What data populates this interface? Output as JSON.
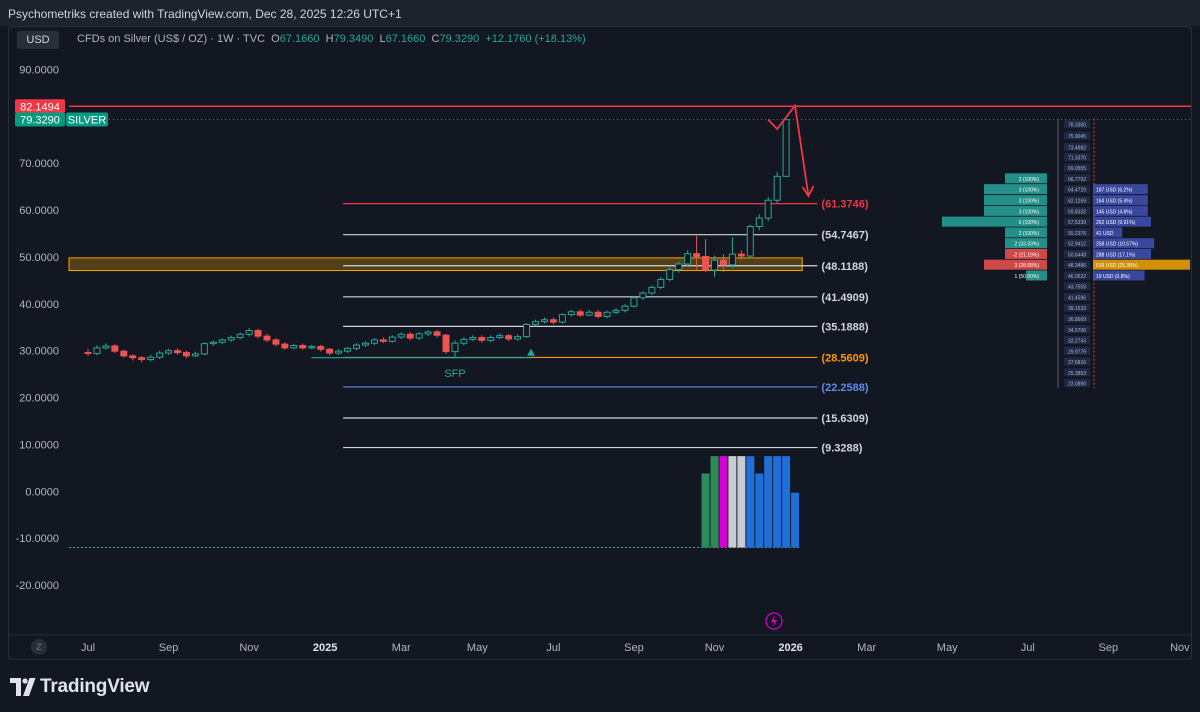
{
  "header": {
    "credit": "Psychometriks created with TradingView.com, Dec 28, 2025 12:26 UTC+1"
  },
  "toolbar": {
    "currency": "USD"
  },
  "legend": {
    "title": "CFDs on Silver (US$ / OZ) · 1W · TVC",
    "open_key": "O",
    "open": "67.1660",
    "high_key": "H",
    "high": "79.3490",
    "low_key": "L",
    "low": "67.1660",
    "close_key": "C",
    "close": "79.3290",
    "change": "+12.1760 (+18.13%)"
  },
  "footer": {
    "brand": "TradingView",
    "zoom_label": "Z"
  },
  "colors": {
    "up": "#26a69a",
    "down": "#ef5350",
    "background": "#131722",
    "resistance": "#f23645",
    "zone": "#f7a600",
    "volume_blue": "#1e6fd9",
    "volume_magenta": "#d500d5",
    "volume_gray": "#c9cbd2",
    "volume_green": "#2e8b57"
  },
  "icons": [
    "lightning-icon",
    "tradingview-logo-icon"
  ],
  "chart_data": {
    "type": "candlestick",
    "symbol": "SILVER",
    "timeframe": "1W",
    "ylim": [
      -20,
      90
    ],
    "y_ticks": [
      "90.0000",
      "80.0000",
      "70.0000",
      "60.0000",
      "50.0000",
      "40.0000",
      "30.0000",
      "20.0000",
      "10.0000",
      "0.0000",
      "-10.0000",
      "-20.0000"
    ],
    "x_ticks": [
      "Jul",
      "Sep",
      "Nov",
      "2025",
      "Mar",
      "May",
      "Jul",
      "Sep",
      "Nov",
      "2026",
      "Mar",
      "May",
      "Jul",
      "Sep",
      "Nov"
    ],
    "x_ticks_bold": [
      "2025",
      "2026"
    ],
    "x_tick_weeks": [
      0,
      9,
      18,
      26.5,
      35,
      43.5,
      52,
      61,
      70,
      78.5,
      87,
      96,
      105,
      114,
      122
    ],
    "price_labels": [
      {
        "text": "82.1494",
        "price": 82.1494,
        "color": "#f23645"
      },
      {
        "text": "79.3290",
        "price": 79.329,
        "color": "#089981",
        "tag": "SILVER"
      }
    ],
    "fib_levels": [
      {
        "label": "(61.3746)",
        "value": 61.3746,
        "color": "#f23645"
      },
      {
        "label": "(54.7467)",
        "value": 54.7467,
        "color": "#d1d4dc"
      },
      {
        "label": "(48.1188)",
        "value": 48.1188,
        "color": "#d1d4dc"
      },
      {
        "label": "(41.4909)",
        "value": 41.4909,
        "color": "#d1d4dc"
      },
      {
        "label": "(35.1888)",
        "value": 35.1888,
        "color": "#d1d4dc"
      },
      {
        "label": "(28.5609)",
        "value": 28.5609,
        "color": "#ff9800"
      },
      {
        "label": "(22.2588)",
        "value": 22.2588,
        "color": "#5b8def"
      },
      {
        "label": "(15.6309)",
        "value": 15.6309,
        "color": "#d1d4dc"
      },
      {
        "label": "(9.3288)",
        "value": 9.3288,
        "color": "#d1d4dc"
      }
    ],
    "annotations": [
      {
        "text": "SFP",
        "week": 41,
        "price": 25.2
      }
    ],
    "resistance_line": 82.1494,
    "zone": [
      47.1,
      49.8
    ],
    "projection_path": [
      [
        76,
        79.3
      ],
      [
        77,
        77.3
      ],
      [
        79,
        82.3
      ],
      [
        80.5,
        63.0
      ]
    ],
    "candles": [
      [
        29.6,
        29.4,
        30.4,
        28.9
      ],
      [
        29.4,
        30.6,
        31.2,
        29.0
      ],
      [
        30.6,
        31.0,
        31.6,
        30.2
      ],
      [
        31.0,
        29.9,
        31.4,
        29.5
      ],
      [
        29.9,
        28.9,
        30.2,
        28.5
      ],
      [
        28.9,
        28.5,
        29.2,
        27.9
      ],
      [
        28.5,
        28.1,
        28.9,
        27.5
      ],
      [
        28.1,
        28.6,
        29.1,
        27.7
      ],
      [
        28.6,
        29.5,
        30.0,
        28.2
      ],
      [
        29.5,
        30.0,
        30.4,
        29.1
      ],
      [
        30.0,
        29.6,
        30.5,
        29.1
      ],
      [
        29.6,
        28.9,
        30.0,
        28.4
      ],
      [
        28.9,
        29.3,
        29.8,
        28.6
      ],
      [
        29.3,
        31.5,
        31.8,
        29.0
      ],
      [
        31.5,
        31.8,
        32.2,
        31.0
      ],
      [
        31.8,
        32.3,
        32.6,
        31.4
      ],
      [
        32.3,
        32.8,
        33.2,
        31.9
      ],
      [
        32.8,
        33.5,
        33.9,
        32.4
      ],
      [
        33.5,
        34.3,
        34.8,
        33.0
      ],
      [
        34.3,
        33.1,
        34.7,
        32.6
      ],
      [
        33.1,
        32.3,
        33.6,
        31.8
      ],
      [
        32.3,
        31.4,
        32.7,
        30.9
      ],
      [
        31.4,
        30.6,
        31.8,
        30.2
      ],
      [
        30.6,
        31.1,
        31.5,
        30.3
      ],
      [
        31.1,
        30.6,
        31.5,
        30.2
      ],
      [
        30.6,
        30.9,
        31.3,
        30.3
      ],
      [
        30.9,
        30.3,
        31.2,
        29.8
      ],
      [
        30.3,
        29.5,
        30.6,
        29.0
      ],
      [
        29.5,
        29.9,
        30.3,
        29.1
      ],
      [
        29.9,
        30.5,
        30.8,
        29.5
      ],
      [
        30.5,
        31.2,
        31.6,
        30.1
      ],
      [
        31.2,
        31.6,
        32.0,
        30.8
      ],
      [
        31.6,
        32.3,
        32.7,
        31.2
      ],
      [
        32.3,
        32.0,
        32.8,
        31.6
      ],
      [
        32.0,
        32.9,
        33.3,
        31.7
      ],
      [
        32.9,
        33.5,
        33.9,
        32.5
      ],
      [
        33.5,
        32.7,
        34.0,
        32.2
      ],
      [
        32.7,
        33.6,
        34.0,
        32.3
      ],
      [
        33.6,
        34.0,
        34.4,
        33.1
      ],
      [
        34.0,
        33.3,
        34.4,
        32.8
      ],
      [
        33.3,
        29.8,
        33.6,
        29.3
      ],
      [
        29.8,
        31.6,
        32.2,
        28.6
      ],
      [
        31.6,
        32.4,
        32.9,
        31.1
      ],
      [
        32.4,
        32.8,
        33.3,
        32.0
      ],
      [
        32.8,
        32.2,
        33.3,
        31.7
      ],
      [
        32.2,
        32.8,
        33.3,
        31.8
      ],
      [
        32.8,
        33.2,
        33.7,
        32.4
      ],
      [
        33.2,
        32.5,
        33.6,
        32.0
      ],
      [
        32.5,
        33.0,
        33.5,
        32.1
      ],
      [
        33.0,
        35.6,
        35.9,
        32.7
      ],
      [
        35.6,
        36.2,
        36.6,
        35.2
      ],
      [
        36.2,
        36.6,
        37.1,
        35.8
      ],
      [
        36.6,
        36.1,
        37.1,
        35.6
      ],
      [
        36.1,
        37.7,
        38.0,
        35.8
      ],
      [
        37.7,
        38.3,
        38.7,
        37.3
      ],
      [
        38.3,
        37.6,
        38.8,
        37.2
      ],
      [
        37.6,
        38.2,
        38.7,
        37.3
      ],
      [
        38.2,
        37.3,
        38.7,
        36.9
      ],
      [
        37.3,
        38.2,
        38.6,
        36.9
      ],
      [
        38.2,
        38.6,
        39.1,
        37.8
      ],
      [
        38.6,
        39.5,
        39.9,
        38.2
      ],
      [
        39.5,
        41.3,
        41.7,
        39.2
      ],
      [
        41.3,
        42.3,
        42.7,
        40.8
      ],
      [
        42.3,
        43.5,
        43.9,
        41.9
      ],
      [
        43.5,
        45.2,
        45.7,
        43.1
      ],
      [
        45.2,
        47.3,
        47.8,
        44.8
      ],
      [
        47.3,
        48.5,
        49.0,
        46.6
      ],
      [
        48.5,
        50.7,
        51.4,
        47.9
      ],
      [
        50.7,
        50.1,
        54.5,
        47.3
      ],
      [
        50.1,
        47.2,
        53.8,
        46.8
      ],
      [
        47.2,
        49.3,
        50.3,
        45.7
      ],
      [
        49.3,
        48.3,
        50.6,
        46.8
      ],
      [
        48.3,
        50.6,
        54.2,
        47.6
      ],
      [
        50.6,
        50.2,
        51.4,
        49.4
      ],
      [
        50.2,
        56.5,
        56.9,
        49.8
      ],
      [
        56.5,
        58.3,
        59.1,
        55.7
      ],
      [
        58.3,
        62.1,
        62.8,
        57.6
      ],
      [
        62.1,
        67.2,
        68.1,
        61.5
      ],
      [
        67.2,
        79.3,
        79.4,
        67.2
      ]
    ],
    "volume_bars": [
      {
        "week": 69,
        "value": 3.8,
        "color": "#2e8b57"
      },
      {
        "week": 70,
        "value": 7.5,
        "color": "#2e8b57"
      },
      {
        "week": 71,
        "value": 7.5,
        "color": "#d500d5"
      },
      {
        "week": 72,
        "value": 7.5,
        "color": "#c9cbd2"
      },
      {
        "week": 73,
        "value": 7.5,
        "color": "#c9cbd2"
      },
      {
        "week": 74,
        "value": 7.5,
        "color": "#1e6fd9"
      },
      {
        "week": 75,
        "value": 3.8,
        "color": "#1e6fd9"
      },
      {
        "week": 76,
        "value": 7.5,
        "color": "#1e6fd9"
      },
      {
        "week": 77,
        "value": 7.5,
        "color": "#1e6fd9"
      },
      {
        "week": 78,
        "value": 7.5,
        "color": "#1e6fd9"
      },
      {
        "week": 79,
        "value": -0.3,
        "color": "#1e6fd9"
      }
    ],
    "volume_baseline": -12,
    "profile_ladder": [
      "78.3300",
      "75.9045",
      "73.4882",
      "71.3370",
      "69.0555",
      "66.7792",
      "64.4729",
      "62.1269",
      "59.8332",
      "57.5339",
      "55.2376",
      "52.9412",
      "50.6449",
      "48.3486",
      "46.0522",
      "43.7559",
      "41.4596",
      "39.1633",
      "36.8669",
      "34.5706",
      "32.2743",
      "29.9779",
      "27.6816",
      "25.3853",
      "23.0890"
    ],
    "profile_rows": [
      {
        "price": 66.7792,
        "label": "2 (100%)",
        "right": "",
        "bar": 0.3,
        "color": "#26a69a"
      },
      {
        "price": 64.4729,
        "label": "3 (100%)",
        "right": "187 USD (6.2%)",
        "bar": 0.45,
        "color": "#26a69a"
      },
      {
        "price": 62.1269,
        "label": "3 (100%)",
        "right": "164 USD (5.4%)",
        "bar": 0.45,
        "color": "#26a69a"
      },
      {
        "price": 59.8332,
        "label": "3 (100%)",
        "right": "145 USD (4.8%)",
        "bar": 0.45,
        "color": "#26a69a"
      },
      {
        "price": 57.5339,
        "label": "5 (100%)",
        "right": "262 USD (9.91%)",
        "bar": 0.75,
        "color": "#26a69a"
      },
      {
        "price": 55.2376,
        "label": "2 (100%)",
        "right": "41 USD",
        "bar": 0.3,
        "color": "#26a69a"
      },
      {
        "price": 52.9412,
        "label": "2 (33.33%)",
        "right": "258 USD (10.57%)",
        "bar": 0.3,
        "color": "#26a69a"
      },
      {
        "price": 50.6449,
        "label": "-2 (21.19%)",
        "right": "288 USD (17.1%)",
        "bar": 0.3,
        "color": "#ef5350"
      },
      {
        "price": 48.3486,
        "label": "3 (28.68%)",
        "right": "516 USD (25.38%)",
        "bar": 0.45,
        "color": "#ef5350"
      },
      {
        "price": 46.0522,
        "label": "1 (50.00%)",
        "right": "19 USD (0.8%)",
        "bar": 0.15,
        "color": "#26a69a"
      }
    ]
  }
}
